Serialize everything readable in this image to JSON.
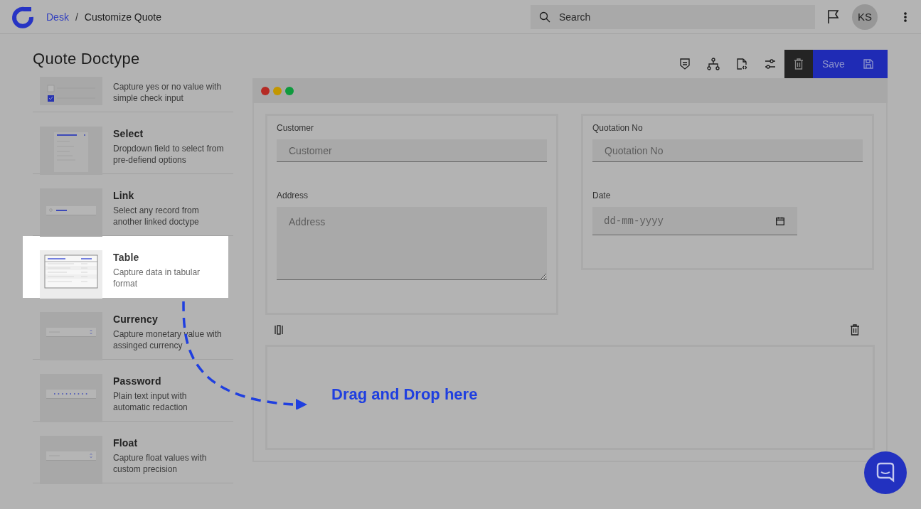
{
  "header": {
    "breadcrumbs": [
      {
        "label": "Desk",
        "link": true
      },
      {
        "label": "Customize Quote",
        "link": false
      }
    ],
    "separator": "/",
    "search": {
      "placeholder": "Search"
    },
    "avatar": "KS"
  },
  "page_title": "Quote Doctype",
  "toolbar": {
    "save_label": "Save"
  },
  "field_types": [
    {
      "kind": "check",
      "description": "Capture yes or no value with simple check input",
      "highlighted": false
    },
    {
      "kind": "select",
      "title": "Select",
      "description": "Dropdown field to select from pre-defiend options",
      "highlighted": false
    },
    {
      "kind": "link",
      "title": "Link",
      "description": "Select any record from another linked doctype",
      "highlighted": false
    },
    {
      "kind": "table",
      "title": "Table",
      "description": "Capture data in tabular format",
      "highlighted": true
    },
    {
      "kind": "currency",
      "title": "Currency",
      "description": "Capture monetary value with assinged currency",
      "highlighted": false
    },
    {
      "kind": "password",
      "title": "Password",
      "description": "Plain text input with automatic redaction",
      "highlighted": false
    },
    {
      "kind": "float",
      "title": "Float",
      "description": "Capture float values with custom precision",
      "highlighted": false
    }
  ],
  "form": {
    "columns": [
      {
        "fields": [
          {
            "kind": "text",
            "label": "Customer",
            "placeholder": "Customer"
          },
          {
            "kind": "textarea",
            "label": "Address",
            "placeholder": "Address"
          }
        ]
      },
      {
        "fields": [
          {
            "kind": "text",
            "label": "Quotation No",
            "placeholder": "Quotation No"
          },
          {
            "kind": "date",
            "label": "Date",
            "placeholder": "dd-mm-yyyy"
          }
        ]
      }
    ]
  },
  "drop_zone": {
    "hint": "Drag and Drop here"
  }
}
